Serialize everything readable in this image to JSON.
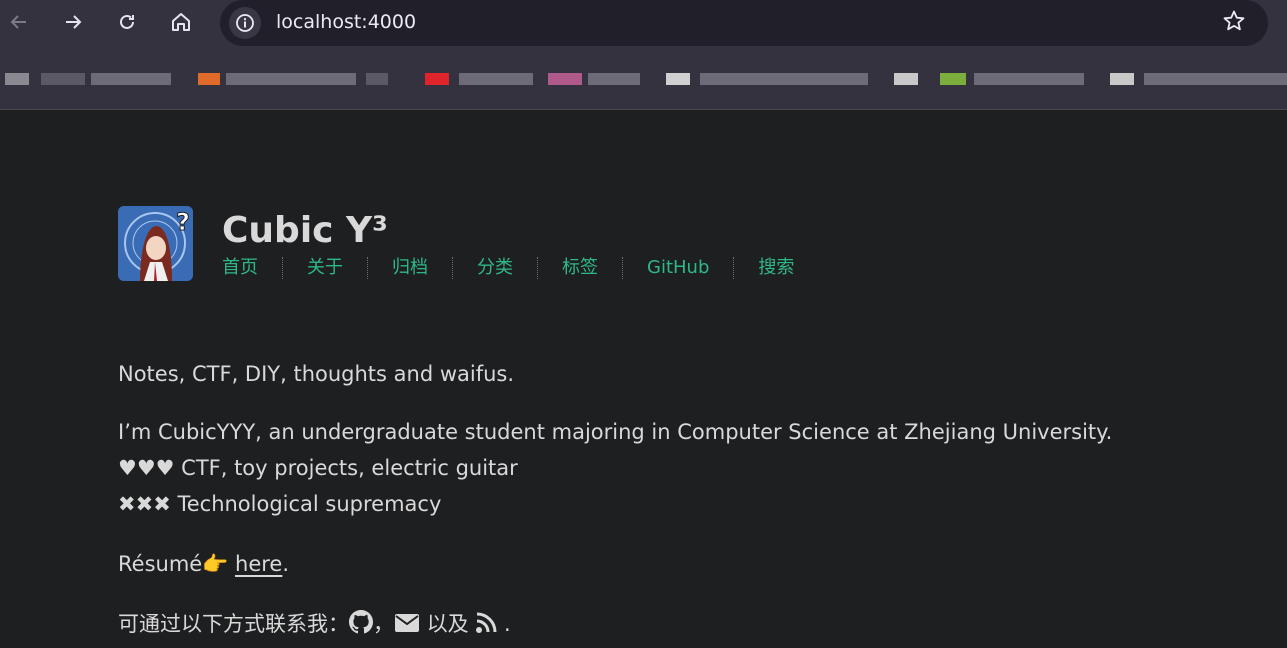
{
  "browser": {
    "url": "localhost:4000",
    "icons": {
      "back": "arrow-left-icon",
      "forward": "arrow-right-icon",
      "reload": "reload-icon",
      "home": "home-icon",
      "site_info": "info-icon",
      "bookmark": "star-icon"
    },
    "bookmark_colors": [
      "#8a8890",
      "#e06a2a",
      "#e0242c",
      "#b05a8c",
      "#d0d0d0",
      "#7cae3e",
      "#c8c8c8"
    ]
  },
  "site": {
    "title": "Cubic Y³",
    "nav": [
      "首页",
      "关于",
      "归档",
      "分类",
      "标签",
      "GitHub",
      "搜索"
    ],
    "accent_color": "#2fb887"
  },
  "content": {
    "tagline": "Notes, CTF, DIY, thoughts and waifus.",
    "intro_line1": "I’m CubicYYY, an undergraduate student majoring in Computer Science at Zhejiang University.",
    "likes_line": "♥♥♥ CTF, toy projects, electric guitar",
    "dislikes_line": "✖✖✖ Technological supremacy",
    "resume_prefix": "Résumé👉 ",
    "resume_link": "here",
    "resume_suffix": ".",
    "contact_prefix": "可通过以下方式联系我：",
    "contact_sep1": "，",
    "contact_sep2": " 以及 ",
    "contact_suffix": " .",
    "contact_icons": [
      "github-icon",
      "email-icon",
      "rss-icon"
    ]
  }
}
